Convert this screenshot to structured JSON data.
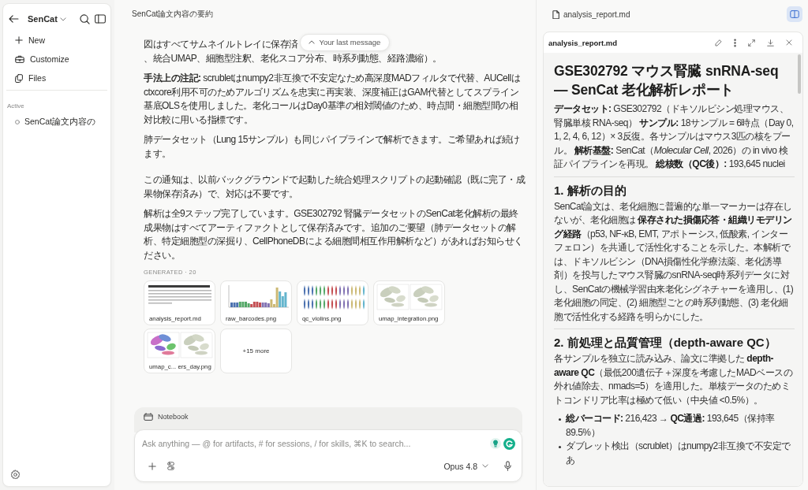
{
  "sidebar": {
    "project": "SenCat",
    "actions": [
      {
        "kind": "new",
        "label": "New"
      },
      {
        "kind": "customize",
        "label": "Customize"
      },
      {
        "kind": "files",
        "label": "Files"
      }
    ],
    "section": "Active",
    "sessions": [
      {
        "title": "SenCat論文内容の",
        "selected": false
      }
    ]
  },
  "conversation": {
    "title": "SenCat論文内容の要約",
    "jump_label": "Your last message",
    "messages": [
      {
        "paragraphs": [
          {
            "kind": "covered",
            "parts": [
              "図はすべてサムネイルトレイに保存済",
              "、統合UMAP、細胞型注釈、老化スコア分布、時系列動態、経路濃縮）。"
            ]
          },
          {
            "kind": "text",
            "text": "**手法上の注記:** scrubletはnumpy2非互換で不安定なため高深度MADフィルタで代替、AUCellはctxcore利用不可のためアルゴリズムを忠実に再実装、深度補正はGAM代替としてスプライン基底OLSを使用しました。老化コールはDay0基準の相対閾値のため、時点間・細胞型間の相対比較に用いる指標です。"
          },
          {
            "kind": "text",
            "text": "肺データセット（Lung 15サンプル）も同じパイプラインで解析できます。ご希望あれば続けます。"
          }
        ]
      },
      {
        "paragraphs": [
          {
            "kind": "text",
            "text": "この通知は、以前バックグラウンドで起動した統合処理スクリプトの起動確認（既に完了・成果物保存済み）で、対応は不要です。"
          },
          {
            "kind": "text",
            "text": "解析は全9ステップ完了しています。GSE302792 腎臓データセットのSenCat老化解析の最終成果物はすべてアーティファクトとして保存済みです。追加のご要望（肺データセットの解析、特定細胞型の深掘り、CellPhoneDBによる細胞間相互作用解析など）があればお知らせください。"
          }
        ],
        "artifacts": {
          "label": "GENERATED · 20",
          "items": [
            {
              "name": "analysis_report.md",
              "kind": "document"
            },
            {
              "name": "raw_barcodes.png",
              "kind": "bars"
            },
            {
              "name": "qc_violins.png",
              "kind": "violins"
            },
            {
              "name": "umap_integration.png",
              "kind": "umap"
            },
            {
              "name": "umap_c... ers_day.png",
              "kind": "clusters"
            }
          ],
          "more": "+15 more"
        }
      }
    ]
  },
  "composer": {
    "mode": "Notebook",
    "placeholder": "Ask anything — @ for artifacts, # for sessions, / for skills, ⌘K to search...",
    "model": "Opus 4.8"
  },
  "preview": {
    "tab": "analysis_report.md",
    "split_view": {
      "on": true
    },
    "card_title": "analysis_report.md",
    "title": "GSE302792 マウス腎臓 snRNA-seq — SenCat 老化解析レポート",
    "blocks": [
      {
        "kind": "paragraph",
        "text": "**データセット:** GSE302792（ドキソルビシン処理マウス、腎臓単核 RNA-seq） **サンプル:** 18サンプル = 6時点（Day 0, 1, 2, 4, 6, 12）× 3反復。各サンプルはマウス3匹の核をプール。 **解析基盤:** SenCat（*Molecular Cell*, 2026）の in vivo 検証パイプラインを再現。 **総核数（QC後）:** 193,645 nuclei"
      },
      {
        "kind": "rule"
      },
      {
        "kind": "heading",
        "text": "1. 解析の目的"
      },
      {
        "kind": "paragraph",
        "text": "SenCat論文は、老化細胞に普遍的な単一マーカーは存在しないが、老化細胞は **保存された損傷応答・組織リモデリング経路**（p53, NF-κB, EMT, アポトーシス, 低酸素, インターフェロン）を共通して活性化することを示した。本解析では、ドキソルビシン（DNA損傷性化学療法薬、老化誘導剤）を投与したマウス腎臓のsnRNA-seq時系列データに対し、SenCatの機械学習由来老化シグネチャーを適用し、(1) 老化細胞の同定、(2) 細胞型ごとの時系列動態、(3) 老化細胞で活性化する経路を明らかにした。"
      },
      {
        "kind": "rule"
      },
      {
        "kind": "heading",
        "text": "2. 前処理と品質管理（depth-aware QC）"
      },
      {
        "kind": "paragraph",
        "text": "各サンプルを独立に読み込み、論文に準拠した **depth-aware QC**（最低200遺伝子＋深度を考慮したMADベースの外れ値除去、nmads=5）を適用した。単核データのためミトコンドリア比率は極めて低い（中央値 <0.5%）。"
      },
      {
        "kind": "list",
        "items": [
          "**総バーコード:** 216,423 → **QC通過:** 193,645（保持率 89.5%）",
          "ダブレット検出（scrublet）はnumpy2非互換で不安定であ"
        ]
      }
    ]
  }
}
